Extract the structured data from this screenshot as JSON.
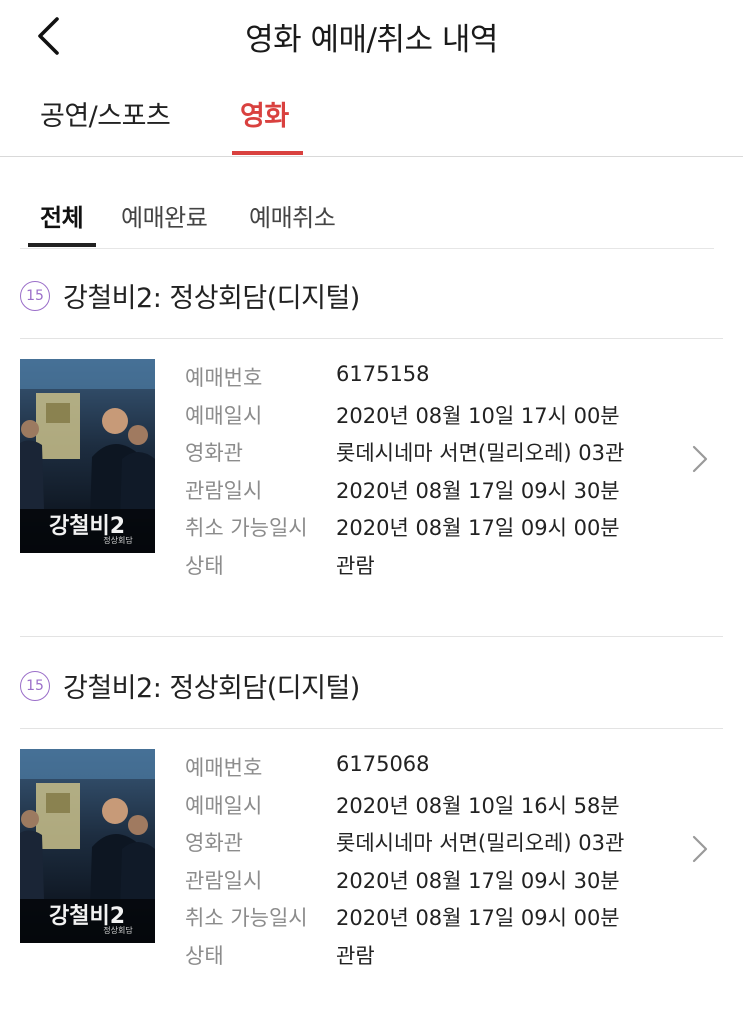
{
  "header": {
    "title": "영화 예매/취소 내역"
  },
  "main_tabs": [
    {
      "label": "공연/스포츠"
    },
    {
      "label": "영화"
    }
  ],
  "sub_tabs": [
    {
      "label": "전체"
    },
    {
      "label": "예매완료"
    },
    {
      "label": "예매취소"
    }
  ],
  "labels": {
    "booking_no": "예매번호",
    "booking_datetime": "예매일시",
    "theater": "영화관",
    "viewing_datetime": "관람일시",
    "cancel_deadline": "취소 가능일시",
    "status": "상태"
  },
  "bookings": [
    {
      "rating": "15",
      "title": "강철비2: 정상회담(디지털)",
      "poster_title": "강철비2",
      "poster_sub": "정상회담",
      "booking_no": "6175158",
      "booking_datetime": "2020년 08월 10일 17시 00분",
      "theater": "롯데시네마 서면(밀리오레) 03관",
      "viewing_datetime": "2020년 08월 17일 09시 30분",
      "cancel_deadline": "2020년 08월 17일 09시 00분",
      "status": "관람"
    },
    {
      "rating": "15",
      "title": "강철비2: 정상회담(디지털)",
      "poster_title": "강철비2",
      "poster_sub": "정상회담",
      "booking_no": "6175068",
      "booking_datetime": "2020년 08월 10일 16시 58분",
      "theater": "롯데시네마 서면(밀리오레) 03관",
      "viewing_datetime": "2020년 08월 17일 09시 30분",
      "cancel_deadline": "2020년 08월 17일 09시 00분",
      "status": "관람"
    }
  ],
  "colors": {
    "accent": "#d9413f",
    "rating_badge": "#9b6fc9",
    "label_gray": "#8c8c8c"
  },
  "icons": {
    "back": "chevron-left-icon",
    "row_arrow": "chevron-right-icon",
    "rating": "age-rating-15-badge"
  }
}
